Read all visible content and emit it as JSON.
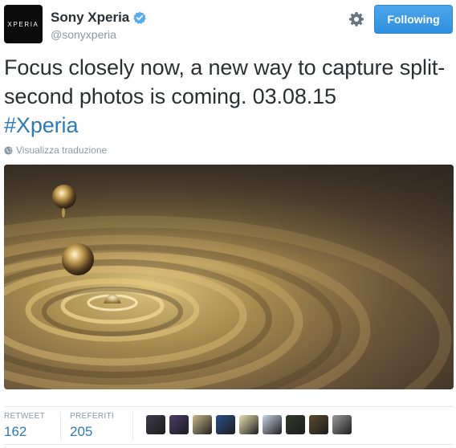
{
  "account": {
    "avatar_text": "XPERIA",
    "display_name": "Sony Xperia",
    "screen_name": "@sonyxperia",
    "verified": true
  },
  "actions": {
    "follow_label": "Following",
    "settings_icon": "gear-icon"
  },
  "tweet": {
    "text": "Focus closely now, a new way to capture split-second photos is coming. 03.08.15",
    "hashtag": "#Xperia",
    "translate_label": "Visualizza traduzione"
  },
  "stats": {
    "retweet_label": "RETWEET",
    "retweet_count": "162",
    "favorites_label": "PREFERITI",
    "favorites_count": "205"
  },
  "favoriters": [
    {
      "color": "#3b3a4a"
    },
    {
      "color": "#4a3b6a"
    },
    {
      "color": "#c9b88a"
    },
    {
      "color": "#2a4f8a"
    },
    {
      "color": "#e9e0b0"
    },
    {
      "color": "#c8d4e8"
    },
    {
      "color": "#2f3a2a"
    },
    {
      "color": "#5a4a2a"
    },
    {
      "color": "#9a9a9a"
    }
  ],
  "colors": {
    "link": "#2b7bb9",
    "muted": "#8899a6",
    "follow_button": "#3d97e4",
    "verified": "#55acee"
  }
}
